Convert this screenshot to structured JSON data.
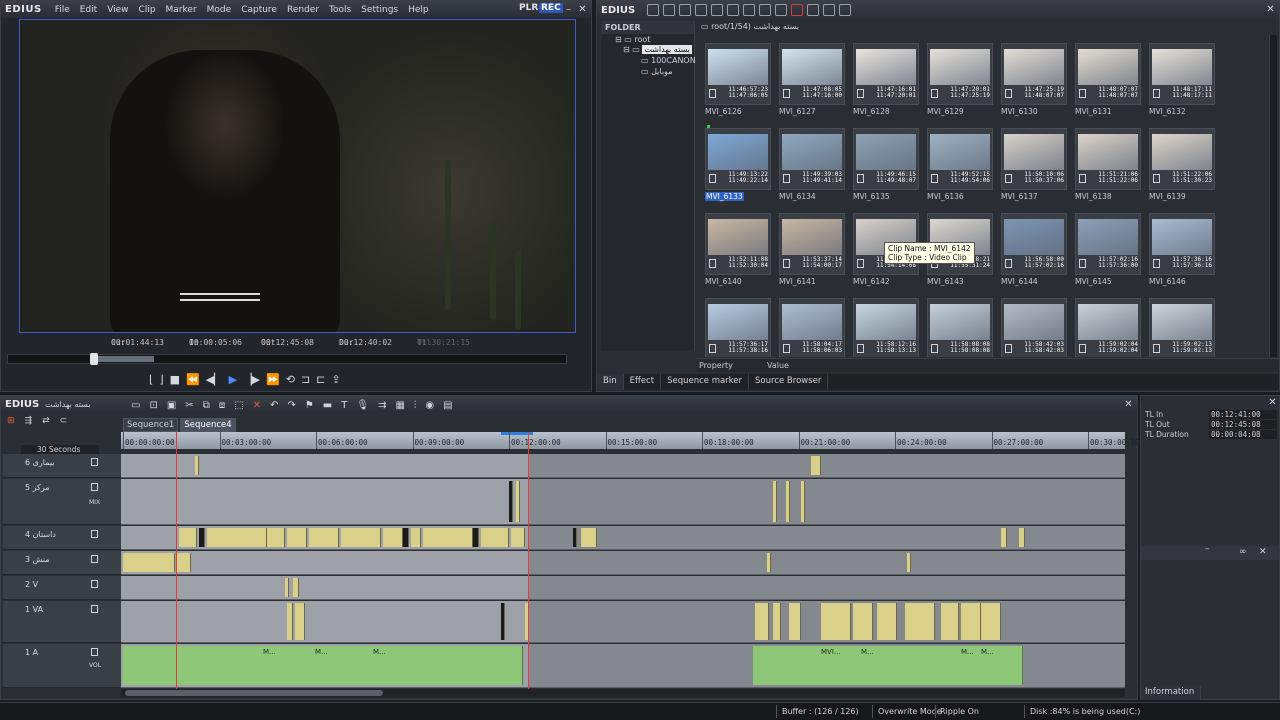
{
  "app": {
    "name": "EDIUS"
  },
  "player": {
    "menu": [
      "File",
      "Edit",
      "View",
      "Clip",
      "Marker",
      "Mode",
      "Capture",
      "Render",
      "Tools",
      "Settings",
      "Help"
    ],
    "plr_label": "PLR",
    "rec_label": "REC",
    "cur_label": "Cur",
    "cur_value": "00:01:44:13",
    "in_label": "In",
    "in_value": "00:00:05:06",
    "out_label": "Out",
    "out_value": "00:12:45:08",
    "dur_label": "Dur",
    "dur_value": "00:12:40:02",
    "ttl_label": "Ttl",
    "ttl_value": "01:30:21:15",
    "transport": [
      "set-in-icon",
      "set-out-icon",
      "stop-icon",
      "rewind-icon",
      "step-back-icon",
      "play-icon",
      "step-forward-icon",
      "fast-forward-icon",
      "loop-icon",
      "insert-icon",
      "overwrite-icon",
      "export-icon"
    ]
  },
  "bin": {
    "folder_title": "FOLDER",
    "tree": [
      "root",
      "بسته بهداشت",
      "100CANON",
      "موبایل"
    ],
    "path": "root/1/54) بسته بهداشت",
    "clips": [
      {
        "name": "MVI_6126",
        "tc": "11:46:57:23\n11:47:06:05",
        "color": "#cfe1ee"
      },
      {
        "name": "MVI_6127",
        "tc": "11:47:08:05\n11:47:16:00",
        "color": "#d4e4ef"
      },
      {
        "name": "MVI_6128",
        "tc": "11:47:16:01\n11:47:20:01",
        "color": "#e8e4df"
      },
      {
        "name": "MVI_6129",
        "tc": "11:47:20:01\n11:47:25:19",
        "color": "#e5e1dc"
      },
      {
        "name": "MVI_6130",
        "tc": "11:47:25:19\n11:48:07:07",
        "color": "#e2ddd6"
      },
      {
        "name": "MVI_6131",
        "tc": "11:48:07:07\n11:48:07:07",
        "color": "#e4ddd4"
      },
      {
        "name": "MVI_6132",
        "tc": "11:48:17:11\n11:48:17:11",
        "color": "#e6e1da"
      },
      {
        "name": "MVI_6133",
        "tc": "11:49:13:22\n11:49:22:14",
        "color": "#7fa9d6",
        "selected": true
      },
      {
        "name": "MVI_6134",
        "tc": "11:49:39:03\n11:49:41:14",
        "color": "#8fa9c0"
      },
      {
        "name": "MVI_6135",
        "tc": "11:49:46:15\n11:49:48:07",
        "color": "#8ea2b3"
      },
      {
        "name": "MVI_6136",
        "tc": "11:49:52:15\n11:49:54:06",
        "color": "#9fb2c3"
      },
      {
        "name": "MVI_6137",
        "tc": "11:50:10:06\n11:50:37:06",
        "color": "#d7d2cb"
      },
      {
        "name": "MVI_6138",
        "tc": "11:51:21:06\n11:51:22:06",
        "color": "#d9d3ca"
      },
      {
        "name": "MVI_6139",
        "tc": "11:51:22:06\n11:51:30:23",
        "color": "#dcd6cd"
      },
      {
        "name": "MVI_6140",
        "tc": "11:52:11:08\n11:52:30:04",
        "color": "#c9b8a4"
      },
      {
        "name": "MVI_6141",
        "tc": "11:53:37:14\n11:54:00:17",
        "color": "#c8b7a3"
      },
      {
        "name": "MVI_6142",
        "tc": "11:54:08:10\n11:54:14:08",
        "color": "#d8d3cc"
      },
      {
        "name": "MVI_6143",
        "tc": "11:55:28:21\n11:55:31:24",
        "color": "#dcd8d2"
      },
      {
        "name": "MVI_6144",
        "tc": "11:56:58:00\n11:57:02:16",
        "color": "#7d95b2"
      },
      {
        "name": "MVI_6145",
        "tc": "11:57:02:16\n11:57:36:00",
        "color": "#8ca0b8"
      },
      {
        "name": "MVI_6146",
        "tc": "11:57:36:16\n11:57:36:16",
        "color": "#a7bdd3"
      },
      {
        "name": "",
        "tc": "11:57:36:17\n11:57:38:16",
        "color": "#b8cde2"
      },
      {
        "name": "",
        "tc": "11:58:04:17\n11:58:06:03",
        "color": "#aebfd0"
      },
      {
        "name": "",
        "tc": "11:58:12:16\n11:58:13:13",
        "color": "#c9d6e2"
      },
      {
        "name": "",
        "tc": "11:58:08:08\n11:58:08:08",
        "color": "#c5d0da"
      },
      {
        "name": "",
        "tc": "11:58:42:03\n11:58:42:03",
        "color": "#b3bcc6"
      },
      {
        "name": "",
        "tc": "11:59:02:04\n11:59:02:04",
        "color": "#c8d0d8"
      },
      {
        "name": "",
        "tc": "11:59:02:13\n11:59:02:13",
        "color": "#ccd4dc"
      }
    ],
    "tooltip": {
      "name_label": "Clip Name : MVI_6142",
      "type_label": "Clip Type : Video Clip"
    },
    "property_label": "Property",
    "value_label": "Value",
    "tabs": [
      "Bin",
      "Effect",
      "Sequence marker",
      "Source Browser"
    ]
  },
  "timeline": {
    "project_name": "بسته بهداشت",
    "sequences": [
      "Sequence1",
      "Sequence4"
    ],
    "scale_label": "30 Seconds",
    "ruler": [
      "00:00:00:00",
      "00:03:00:00",
      "00:06:00:00",
      "00:09:00:00",
      "00:12:00:00",
      "00:15:00:00",
      "00:18:00:00",
      "00:21:00:00",
      "00:24:00:00",
      "00:27:00:00",
      "00:30:00:00"
    ],
    "tracks": [
      {
        "label": "6 بیماری",
        "type": "video"
      },
      {
        "label": "5 مرکز",
        "type": "video"
      },
      {
        "label": "4 داستان",
        "type": "video"
      },
      {
        "label": "3 منش",
        "type": "video"
      },
      {
        "label": "2 V",
        "type": "video"
      },
      {
        "label": "1 VA",
        "type": "va"
      },
      {
        "label": "1 A",
        "type": "audio"
      }
    ],
    "mix_label": "MIX",
    "vol_label": "VOL",
    "audio_text": [
      "M...",
      "M...",
      "M...",
      "MVI...",
      "M...",
      "M...",
      "M..."
    ]
  },
  "info": {
    "rows": [
      {
        "key": "TL In",
        "value": "00:12:41:00"
      },
      {
        "key": "TL Out",
        "value": "00:12:45:08"
      },
      {
        "key": "TL Duration",
        "value": "00:00:04:08"
      }
    ],
    "tab": "Information"
  },
  "status": {
    "buffer": "Buffer : (126 / 126)",
    "mode": "Overwrite Mode",
    "ripple": "Ripple On",
    "disk": "Disk :84% is being used(C:)"
  }
}
